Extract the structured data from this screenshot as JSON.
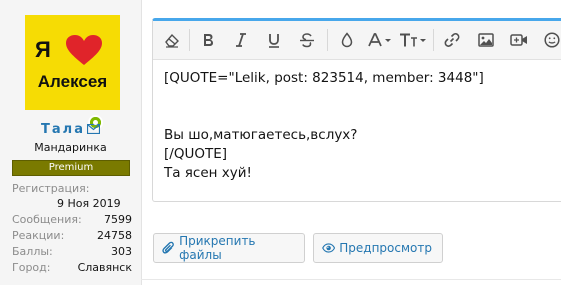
{
  "avatar": {
    "text_ya": "Я",
    "text_name": "Алексея"
  },
  "user": {
    "name": "Тала",
    "title": "Мандаринка",
    "banner": "Premium"
  },
  "stats": {
    "registration_label": "Регистрация:",
    "registration_value": "9 Ноя 2019",
    "rows": [
      {
        "label": "Сообщения:",
        "value": "7599"
      },
      {
        "label": "Реакции:",
        "value": "24758"
      },
      {
        "label": "Баллы:",
        "value": "303"
      },
      {
        "label": "Город:",
        "value": "Славянск"
      }
    ]
  },
  "toolbar": {
    "icons": [
      "eraser-icon",
      "bold-icon",
      "italic-icon",
      "underline-icon",
      "strikethrough-icon",
      "text-color-icon",
      "font-family-icon",
      "font-size-icon",
      "link-icon",
      "image-icon",
      "media-icon",
      "smilie-icon"
    ]
  },
  "editor": {
    "lines": [
      "[QUOTE=\"Lelik, post: 823514, member: 3448\"]",
      "",
      "",
      "Вы шо,матюгаетесь,вслух?",
      "[/QUOTE]",
      "Та ясен хуй!"
    ]
  },
  "buttons": {
    "attach": "Прикрепить файлы",
    "preview": "Предпросмотр"
  },
  "colors": {
    "accent": "#47a7eb",
    "link": "#2577b1",
    "banner_bg": "#7a7a00",
    "avatar_bg": "#f6dc04",
    "heart": "#e0242a",
    "online": "#7fb900"
  }
}
